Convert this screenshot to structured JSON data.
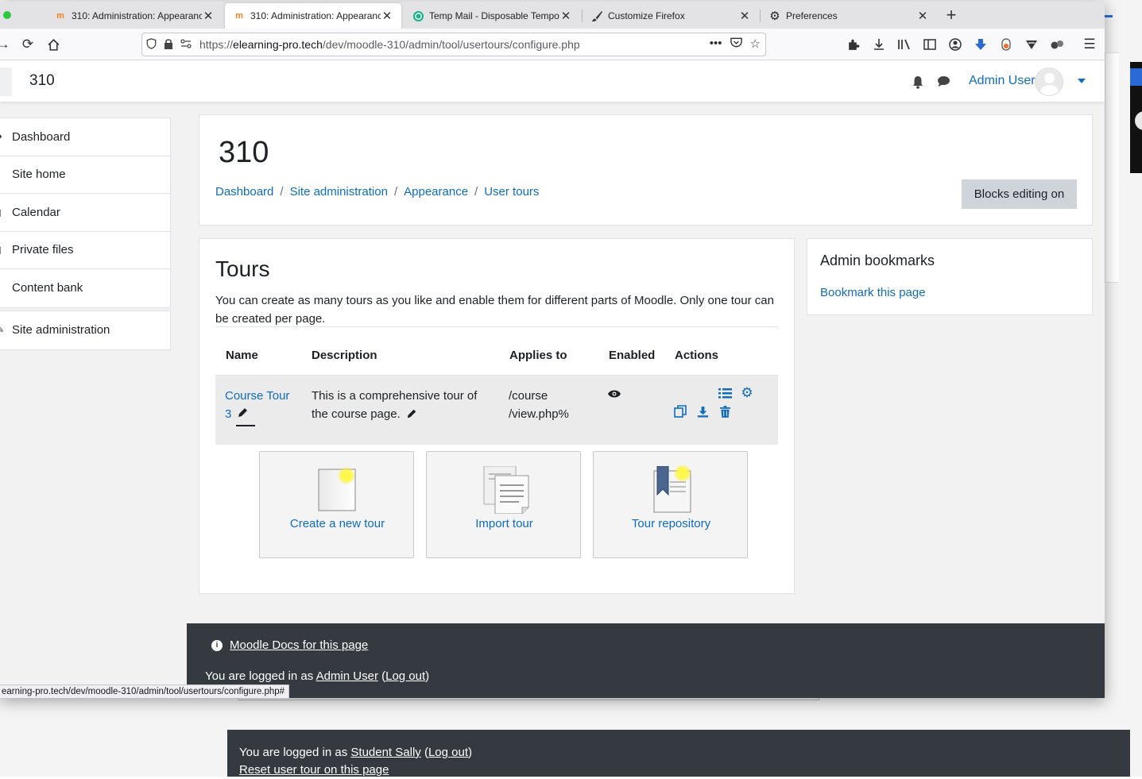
{
  "browser": {
    "tabs": [
      {
        "title": "310: Administration: Appearance",
        "active": false
      },
      {
        "title": "310: Administration: Appearance",
        "active": true
      },
      {
        "title": "Temp Mail - Disposable Temporary",
        "active": false
      },
      {
        "title": "Customize Firefox",
        "active": false
      },
      {
        "title": "Preferences",
        "active": false
      }
    ],
    "url": {
      "prefix": "https://",
      "domain": "elearning-pro.tech",
      "path": "/dev/moodle-310/admin/tool/usertours/configure.php"
    },
    "status_url": "earning-pro.tech/dev/moodle-310/admin/tool/usertours/configure.php#"
  },
  "header": {
    "site_name": "310",
    "user_name": "Admin User"
  },
  "nav": {
    "primary": [
      "Dashboard",
      "Site home",
      "Calendar",
      "Private files",
      "Content bank"
    ],
    "admin": "Site administration"
  },
  "page": {
    "title": "310",
    "breadcrumb": [
      "Dashboard",
      "Site administration",
      "Appearance",
      "User tours"
    ],
    "blocks_button": "Blocks editing on"
  },
  "tours": {
    "title": "Tours",
    "description": "You can create as many tours as you like and enable them for different parts of Moodle. Only one tour can be created per page.",
    "columns": [
      "Name",
      "Description",
      "Applies to",
      "Enabled",
      "Actions"
    ],
    "rows": [
      {
        "name_line1": "Course Tour",
        "name_line2": "3",
        "description_line1": "This is a comprehensive tour of",
        "description_line2": "the course page.",
        "applies_line1": "/course",
        "applies_line2": "/view.php%"
      }
    ],
    "tiles": [
      "Create a new tour",
      "Import tour",
      "Tour repository"
    ]
  },
  "bookmarks": {
    "title": "Admin bookmarks",
    "link": "Bookmark this page"
  },
  "footer": {
    "docs_link": "Moodle Docs for this page",
    "login_prefix": "You are logged in as ",
    "login_user": "Admin User",
    "logout": "Log out"
  },
  "background_footer": {
    "login_prefix": "You are logged in as ",
    "login_user": "Student Sally",
    "logout": "Log out",
    "reset_link": "Reset user tour on this page"
  },
  "colors": {
    "link": "#0f6cbf",
    "footer_bg": "#343a40",
    "button_grey": "#ced4da"
  }
}
